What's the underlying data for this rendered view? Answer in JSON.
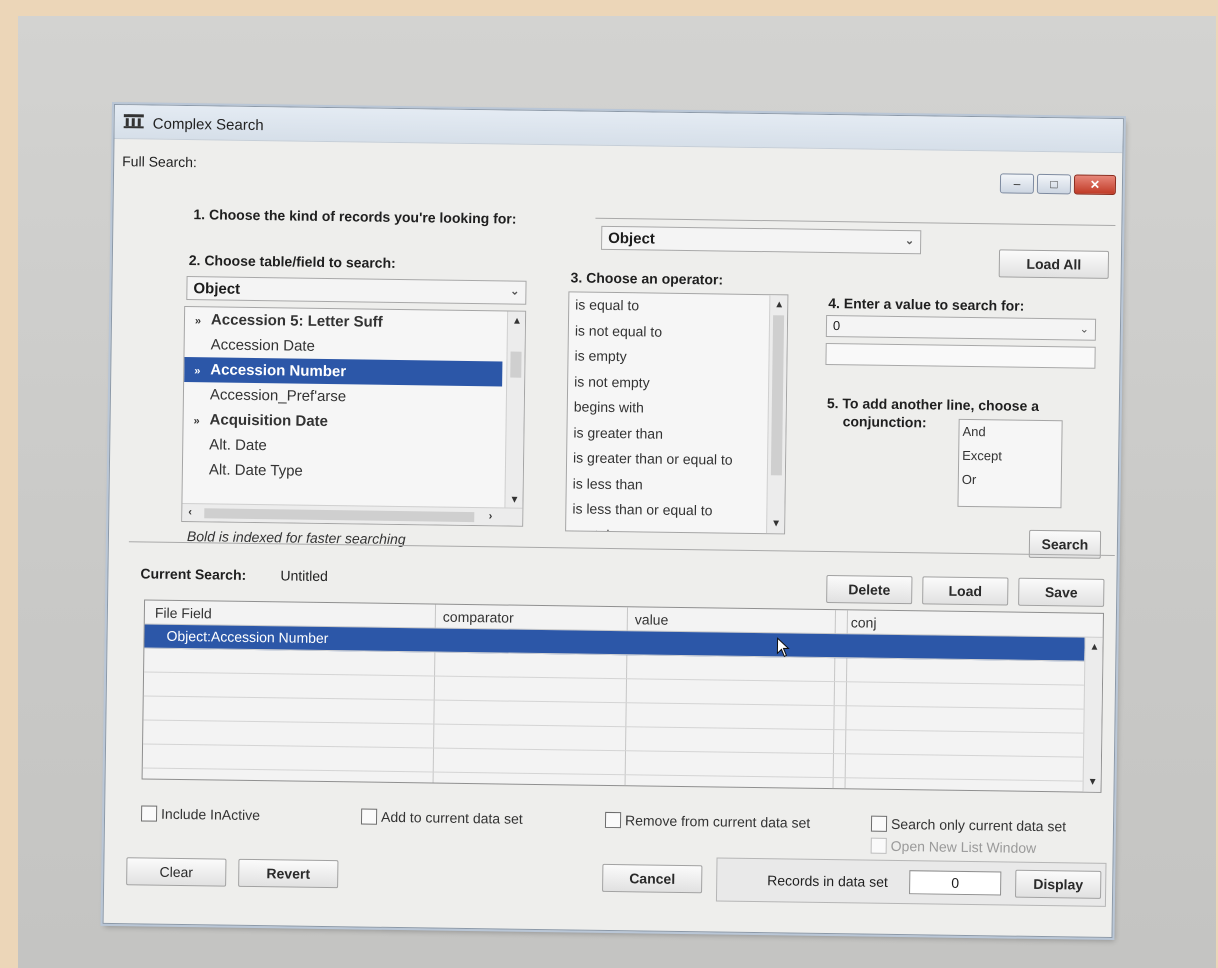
{
  "window": {
    "title": "Complex Search",
    "full_search_label": "Full Search:"
  },
  "step1": {
    "label": "1. Choose the kind of records you're looking for:",
    "value": "Object",
    "load_all_label": "Load All"
  },
  "step2": {
    "label": "2. Choose table/field to search:",
    "table_value": "Object",
    "fields": [
      {
        "label": "Accession 5: Letter Suff",
        "bold": true,
        "arrow": true
      },
      {
        "label": "Accession Date",
        "bold": false,
        "arrow": false
      },
      {
        "label": "Accession Number",
        "bold": true,
        "arrow": true,
        "selected": true
      },
      {
        "label": "Accession_Pref'arse",
        "bold": false,
        "arrow": false
      },
      {
        "label": "Acquisition Date",
        "bold": true,
        "arrow": true
      },
      {
        "label": "Alt. Date",
        "bold": false,
        "arrow": false
      },
      {
        "label": "Alt. Date Type",
        "bold": false,
        "arrow": false
      }
    ],
    "note": "Bold is indexed for faster searching"
  },
  "step3": {
    "label": "3. Choose an operator:",
    "operators": [
      "is equal to",
      "is not equal to",
      "is empty",
      "is not empty",
      "begins with",
      "is greater than",
      "is greater than or equal to",
      "is less than",
      "is less than or equal to",
      "contains"
    ]
  },
  "step4": {
    "label": "4. Enter a value to search for:",
    "combo_value": "0",
    "text_value": ""
  },
  "step5": {
    "label_line1": "5. To add another line, choose a",
    "label_line2": "conjunction:",
    "conjunctions": [
      "And",
      "Except",
      "Or"
    ],
    "search_label": "Search"
  },
  "current_search": {
    "label": "Current Search:",
    "name": "Untitled",
    "delete_label": "Delete",
    "load_label": "Load",
    "save_label": "Save",
    "columns": [
      "File Field",
      "comparator",
      "value",
      "conj"
    ],
    "rows": [
      {
        "file_field": "Object:Accession Number",
        "comparator": "",
        "value": "",
        "conj": ""
      }
    ]
  },
  "options": {
    "include_inactive": "Include InActive",
    "add_to_current": "Add to current data set",
    "remove_from_current": "Remove from current data set",
    "search_only_current": "Search only current data set",
    "open_new_list": "Open New List Window"
  },
  "footer": {
    "clear_label": "Clear",
    "revert_label": "Revert",
    "cancel_label": "Cancel",
    "records_label": "Records in data set",
    "records_value": "0",
    "display_label": "Display"
  },
  "colors": {
    "selection": "#2c57a8",
    "close_button": "#c03a26"
  }
}
